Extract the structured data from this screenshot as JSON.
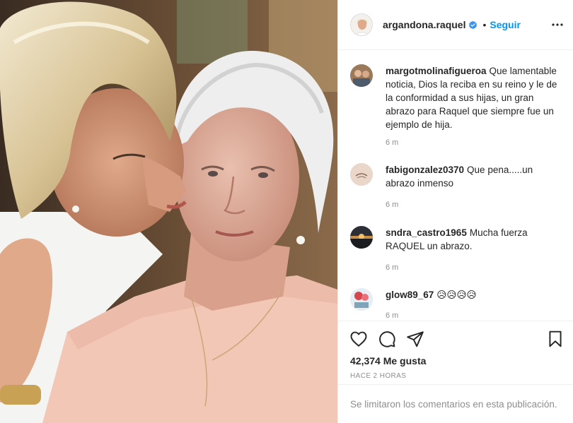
{
  "post": {
    "username": "argandona.raquel",
    "separator": "•",
    "follow_label": "Seguir",
    "likes": "42,374 Me gusta",
    "time_ago": "HACE 2 HORAS",
    "comments_limited_notice": "Se limitaron los comentarios en esta publicación.",
    "comments": [
      {
        "username": "margotmolinafigueroa",
        "text": "Que lamentable noticia, Dios la reciba en su reino y le de la conformidad a sus hijas, un gran abrazo para Raquel que siempre fue un ejemplo de hija.",
        "time": "6 m"
      },
      {
        "username": "fabigonzalez0370",
        "text": "Que pena.....un abrazo inmenso",
        "time": "6 m"
      },
      {
        "username": "sndra_castro1965",
        "text": "Mucha fuerza RAQUEL un abrazo.",
        "time": "6 m"
      },
      {
        "username": "glow89_67",
        "text": "😥😥😥😥",
        "time": "6 m"
      }
    ]
  },
  "icons": {
    "verified": "verified-badge-icon",
    "more": "more-options-icon",
    "like": "heart-icon",
    "comment": "comment-icon",
    "share": "paper-plane-icon",
    "save": "bookmark-icon"
  },
  "colors": {
    "accent": "#0095f6",
    "text": "#262626",
    "muted": "#8e8e8e",
    "divider": "#efefef"
  }
}
